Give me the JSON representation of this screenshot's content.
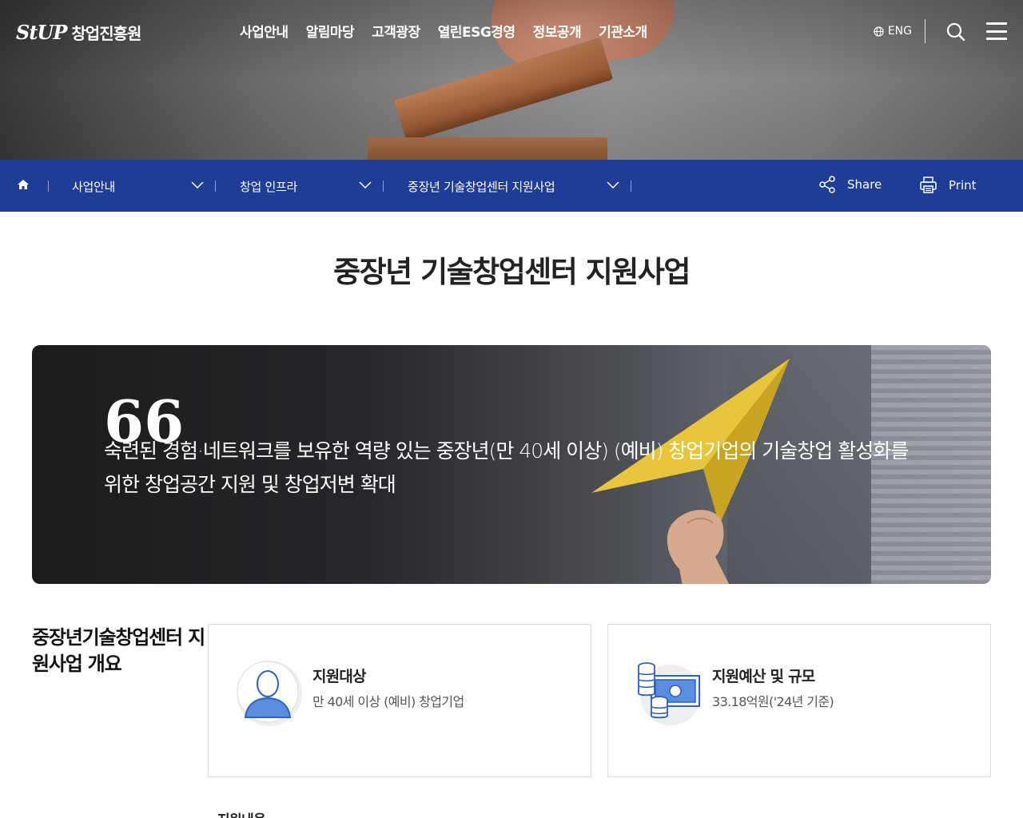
{
  "header": {
    "logo_mark": "StUP",
    "logo_name": "창업진흥원",
    "nav": [
      "사업안내",
      "알림마당",
      "고객광장",
      "열린ESG경영",
      "정보공개",
      "기관소개"
    ],
    "lang_label": "ENG"
  },
  "location": {
    "crumbs": [
      "사업안내",
      "창업 인프라",
      "중장년 기술창업센터 지원사업"
    ],
    "share_label": "Share",
    "print_label": "Print"
  },
  "page": {
    "title": "중장년 기술창업센터 지원사업"
  },
  "banner": {
    "quote_mark": "66",
    "text": "숙련된 경험·네트워크를 보유한 역량 있는 중장년(만 40세 이상) (예비) 창업기업의 기술창업 활성화를 위한 창업공간 지원 및 창업저변 확대"
  },
  "overview": {
    "title": "중장년기술창업센터 지원사업 개요",
    "cards": [
      {
        "label": "지원대상",
        "value": "만 40세 이상 (예비) 창업기업",
        "icon": "person-icon"
      },
      {
        "label": "지원예산 및 규모",
        "value": "33.18억원('24년 기준)",
        "icon": "money-icon"
      }
    ],
    "next_section_title": "지원내용"
  },
  "colors": {
    "nav_bar": "#1f3c97",
    "icon_blue": "#2f5fbf"
  }
}
